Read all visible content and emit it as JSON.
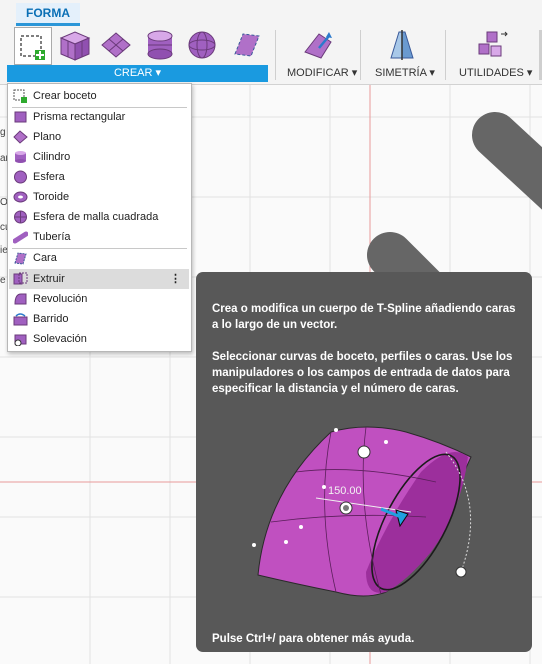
{
  "ribbon": {
    "tab_label": "FORMA",
    "crear_label": "CREAR ▾",
    "groups": [
      {
        "label": "MODIFICAR ▾"
      },
      {
        "label": "SIMETRÍA ▾"
      },
      {
        "label": "UTILIDADES ▾"
      }
    ]
  },
  "menu": {
    "items": [
      {
        "label": "Crear boceto",
        "icon": "sketch-icon"
      },
      {
        "label": "Prisma rectangular",
        "icon": "box-icon"
      },
      {
        "label": "Plano",
        "icon": "plane-icon"
      },
      {
        "label": "Cilindro",
        "icon": "cylinder-icon"
      },
      {
        "label": "Esfera",
        "icon": "sphere-icon"
      },
      {
        "label": "Toroide",
        "icon": "torus-icon"
      },
      {
        "label": "Esfera de malla cuadrada",
        "icon": "quadball-icon"
      },
      {
        "label": "Tubería",
        "icon": "pipe-icon"
      },
      {
        "label": "Cara",
        "icon": "face-icon"
      },
      {
        "label": "Extruir",
        "icon": "extrude-icon",
        "more": "⋮"
      },
      {
        "label": "Revolución",
        "icon": "revolve-icon"
      },
      {
        "label": "Barrido",
        "icon": "sweep-icon"
      },
      {
        "label": "Solevación",
        "icon": "loft-icon"
      }
    ]
  },
  "tooltip": {
    "para1": "Crea o modifica un cuerpo de T-Spline añadiendo caras a lo largo de un vector.",
    "para2": "Seleccionar curvas de boceto, perfiles o caras. Use los manipuladores o los campos de entrada de datos para especificar la distancia y el número de caras.",
    "dimension": "150.00",
    "footer": "Pulse Ctrl+/ para obtener más ayuda."
  },
  "side_fragments": [
    "g",
    "ar",
    "Or",
    "cu",
    "ie",
    "e"
  ],
  "colors": {
    "accent": "#1a9ae0",
    "tooltip_bg": "#585858",
    "tspline_purple": "#c050c0"
  }
}
